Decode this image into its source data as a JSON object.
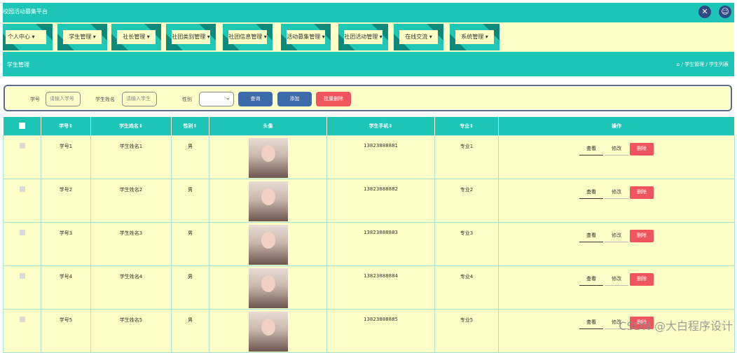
{
  "app": {
    "title": "校园活动募集平台"
  },
  "topbar": {
    "icons": [
      "expand-icon",
      "user-icon"
    ]
  },
  "nav": {
    "items": [
      {
        "label": "个人中心"
      },
      {
        "label": "学生管理"
      },
      {
        "label": "社长管理"
      },
      {
        "label": "社团类别管理"
      },
      {
        "label": "社团信息管理"
      },
      {
        "label": "活动募集管理"
      },
      {
        "label": "社团活动管理"
      },
      {
        "label": "在线交流"
      },
      {
        "label": "系统管理"
      }
    ]
  },
  "page": {
    "title": "学生管理",
    "breadcrumb": "/ 学生管理 / 学生列表"
  },
  "search": {
    "xuehao_label": "学号",
    "xuehao_placeholder": "请输入学号",
    "name_label": "学生姓名",
    "name_placeholder": "请输入学生",
    "gender_label": "性别",
    "query_btn": "查询",
    "add_btn": "添加",
    "batch_delete_btn": "批量删除",
    "colors": {
      "query": "#3d6aa8",
      "add": "#3d6aa8",
      "batch_delete": "#f0545c"
    }
  },
  "table": {
    "columns": [
      "",
      "学号",
      "学生姓名",
      "性别",
      "头像",
      "学生手机",
      "专业",
      "操作"
    ],
    "rows": [
      {
        "xuehao": "学号1",
        "name": "学生姓名1",
        "gender": "男",
        "phone": "13823888881",
        "major": "专业1"
      },
      {
        "xuehao": "学号2",
        "name": "学生姓名2",
        "gender": "男",
        "phone": "13823888882",
        "major": "专业2"
      },
      {
        "xuehao": "学号3",
        "name": "学生姓名3",
        "gender": "男",
        "phone": "13823888883",
        "major": "专业3"
      },
      {
        "xuehao": "学号4",
        "name": "学生姓名4",
        "gender": "男",
        "phone": "13823888884",
        "major": "专业4"
      },
      {
        "xuehao": "学号5",
        "name": "学生姓名5",
        "gender": "男",
        "phone": "13823888885",
        "major": "专业5"
      }
    ],
    "actions": {
      "view": "查看",
      "edit": "修改",
      "delete": "删除"
    }
  },
  "watermark": "CSDN @大白程序设计"
}
